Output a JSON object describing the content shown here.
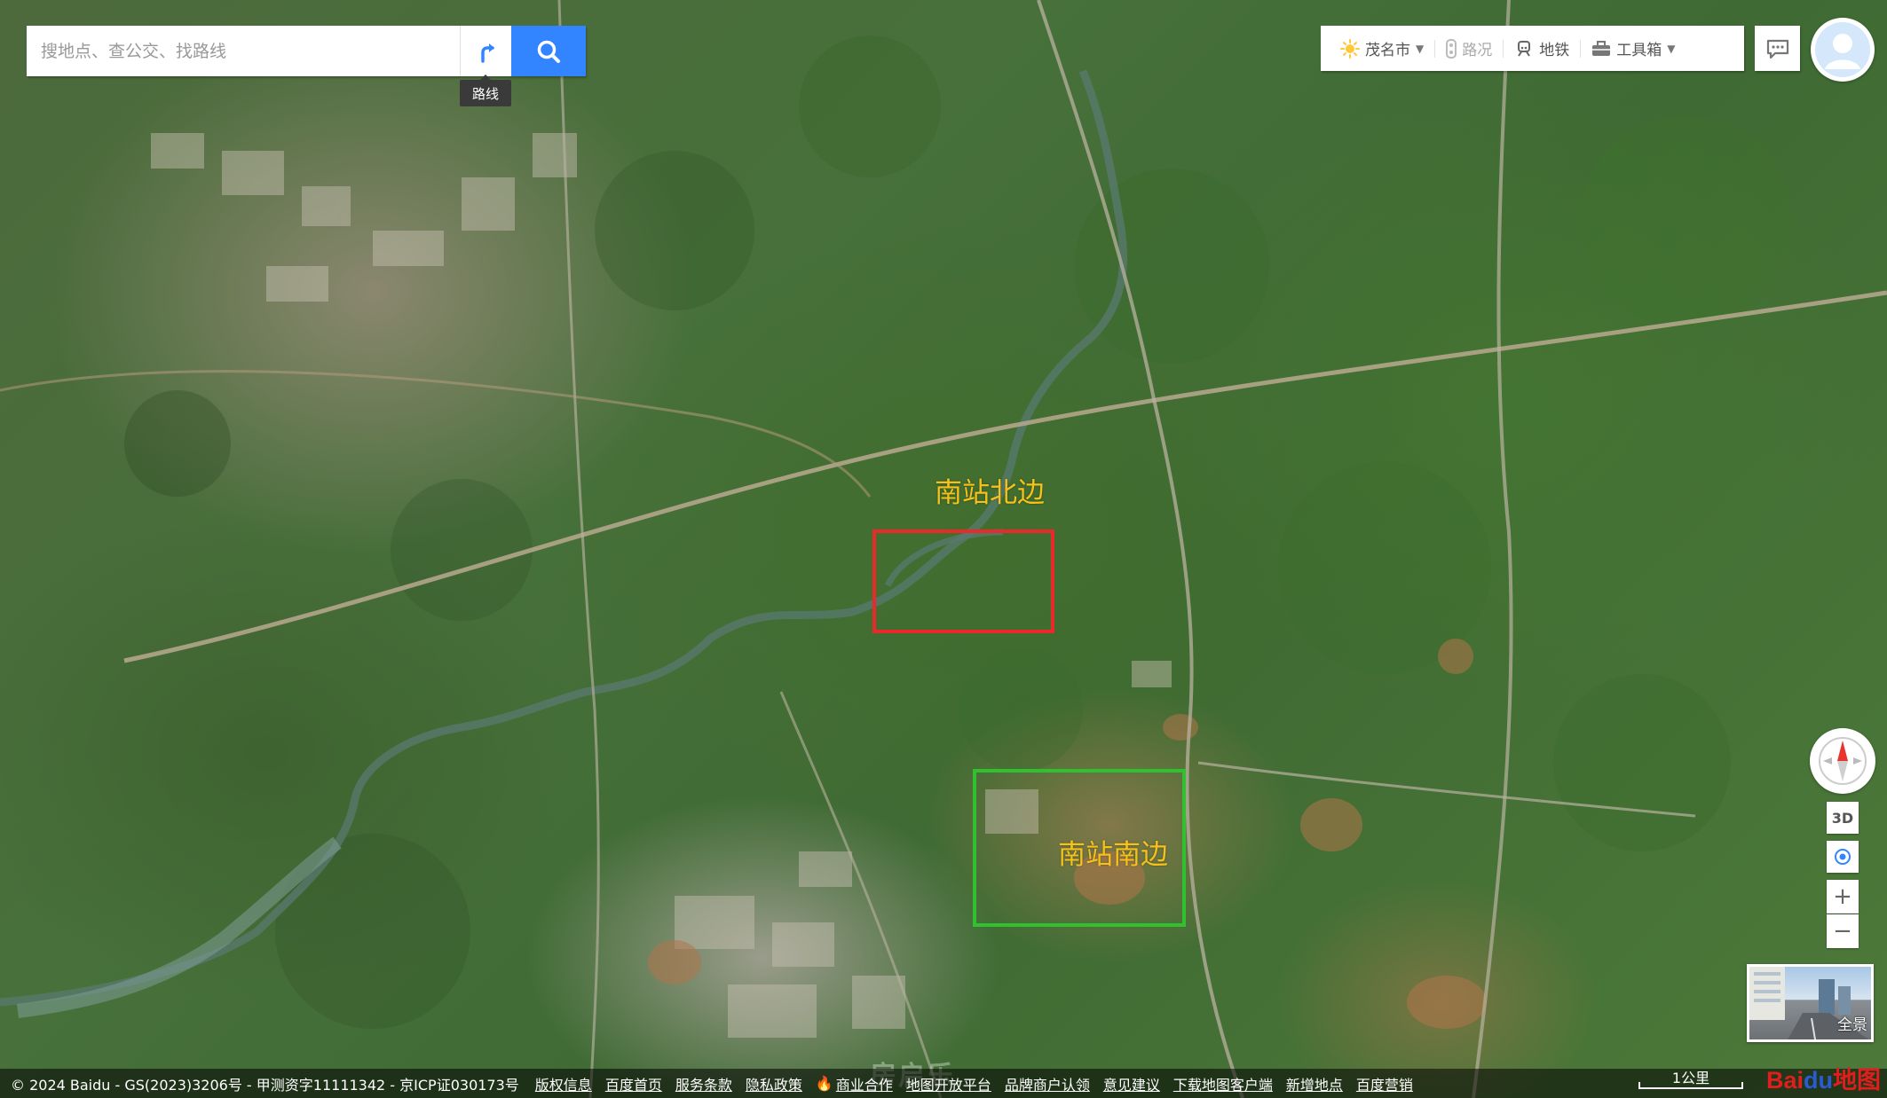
{
  "search": {
    "placeholder": "搜地点、查公交、找路线",
    "route_tooltip": "路线"
  },
  "toolbar": {
    "city": "茂名市",
    "traffic": "路况",
    "subway": "地铁",
    "toolbox": "工具箱"
  },
  "annotations": {
    "north_label": "南站北边",
    "south_label": "南站南边",
    "north_box_color": "#ea2a2a",
    "south_box_color": "#2fc12f",
    "label_color": "#f6c21a"
  },
  "controls": {
    "three_d": "3D",
    "zoom_in": "+",
    "zoom_out": "−",
    "panorama": "全景"
  },
  "footer": {
    "copyright": "© 2024 Baidu - GS(2023)3206号 - 甲测资字11111342 - 京ICP证030173号",
    "links": [
      "版权信息",
      "百度首页",
      "服务条款",
      "隐私政策",
      "商业合作",
      "地图开放平台",
      "品牌商户认领",
      "意见建议",
      "下载地图客户端",
      "新增地点",
      "百度营销"
    ]
  },
  "scale": "1公里",
  "brand": {
    "logo_prefix": "Bai",
    "logo_du": "du",
    "logo_suffix": "地图"
  },
  "watermark": "房启乐"
}
